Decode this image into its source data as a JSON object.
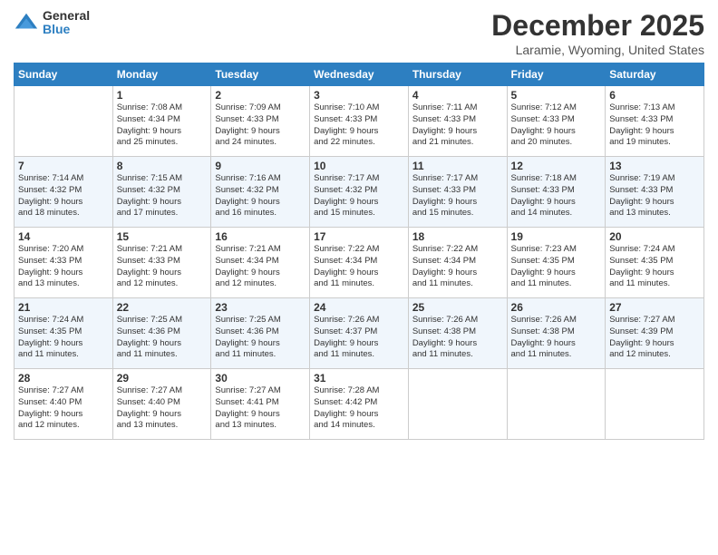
{
  "logo": {
    "general": "General",
    "blue": "Blue"
  },
  "title": "December 2025",
  "subtitle": "Laramie, Wyoming, United States",
  "days_of_week": [
    "Sunday",
    "Monday",
    "Tuesday",
    "Wednesday",
    "Thursday",
    "Friday",
    "Saturday"
  ],
  "weeks": [
    [
      {
        "num": "",
        "info": ""
      },
      {
        "num": "1",
        "info": "Sunrise: 7:08 AM\nSunset: 4:34 PM\nDaylight: 9 hours\nand 25 minutes."
      },
      {
        "num": "2",
        "info": "Sunrise: 7:09 AM\nSunset: 4:33 PM\nDaylight: 9 hours\nand 24 minutes."
      },
      {
        "num": "3",
        "info": "Sunrise: 7:10 AM\nSunset: 4:33 PM\nDaylight: 9 hours\nand 22 minutes."
      },
      {
        "num": "4",
        "info": "Sunrise: 7:11 AM\nSunset: 4:33 PM\nDaylight: 9 hours\nand 21 minutes."
      },
      {
        "num": "5",
        "info": "Sunrise: 7:12 AM\nSunset: 4:33 PM\nDaylight: 9 hours\nand 20 minutes."
      },
      {
        "num": "6",
        "info": "Sunrise: 7:13 AM\nSunset: 4:33 PM\nDaylight: 9 hours\nand 19 minutes."
      }
    ],
    [
      {
        "num": "7",
        "info": "Sunrise: 7:14 AM\nSunset: 4:32 PM\nDaylight: 9 hours\nand 18 minutes."
      },
      {
        "num": "8",
        "info": "Sunrise: 7:15 AM\nSunset: 4:32 PM\nDaylight: 9 hours\nand 17 minutes."
      },
      {
        "num": "9",
        "info": "Sunrise: 7:16 AM\nSunset: 4:32 PM\nDaylight: 9 hours\nand 16 minutes."
      },
      {
        "num": "10",
        "info": "Sunrise: 7:17 AM\nSunset: 4:32 PM\nDaylight: 9 hours\nand 15 minutes."
      },
      {
        "num": "11",
        "info": "Sunrise: 7:17 AM\nSunset: 4:33 PM\nDaylight: 9 hours\nand 15 minutes."
      },
      {
        "num": "12",
        "info": "Sunrise: 7:18 AM\nSunset: 4:33 PM\nDaylight: 9 hours\nand 14 minutes."
      },
      {
        "num": "13",
        "info": "Sunrise: 7:19 AM\nSunset: 4:33 PM\nDaylight: 9 hours\nand 13 minutes."
      }
    ],
    [
      {
        "num": "14",
        "info": "Sunrise: 7:20 AM\nSunset: 4:33 PM\nDaylight: 9 hours\nand 13 minutes."
      },
      {
        "num": "15",
        "info": "Sunrise: 7:21 AM\nSunset: 4:33 PM\nDaylight: 9 hours\nand 12 minutes."
      },
      {
        "num": "16",
        "info": "Sunrise: 7:21 AM\nSunset: 4:34 PM\nDaylight: 9 hours\nand 12 minutes."
      },
      {
        "num": "17",
        "info": "Sunrise: 7:22 AM\nSunset: 4:34 PM\nDaylight: 9 hours\nand 11 minutes."
      },
      {
        "num": "18",
        "info": "Sunrise: 7:22 AM\nSunset: 4:34 PM\nDaylight: 9 hours\nand 11 minutes."
      },
      {
        "num": "19",
        "info": "Sunrise: 7:23 AM\nSunset: 4:35 PM\nDaylight: 9 hours\nand 11 minutes."
      },
      {
        "num": "20",
        "info": "Sunrise: 7:24 AM\nSunset: 4:35 PM\nDaylight: 9 hours\nand 11 minutes."
      }
    ],
    [
      {
        "num": "21",
        "info": "Sunrise: 7:24 AM\nSunset: 4:35 PM\nDaylight: 9 hours\nand 11 minutes."
      },
      {
        "num": "22",
        "info": "Sunrise: 7:25 AM\nSunset: 4:36 PM\nDaylight: 9 hours\nand 11 minutes."
      },
      {
        "num": "23",
        "info": "Sunrise: 7:25 AM\nSunset: 4:36 PM\nDaylight: 9 hours\nand 11 minutes."
      },
      {
        "num": "24",
        "info": "Sunrise: 7:26 AM\nSunset: 4:37 PM\nDaylight: 9 hours\nand 11 minutes."
      },
      {
        "num": "25",
        "info": "Sunrise: 7:26 AM\nSunset: 4:38 PM\nDaylight: 9 hours\nand 11 minutes."
      },
      {
        "num": "26",
        "info": "Sunrise: 7:26 AM\nSunset: 4:38 PM\nDaylight: 9 hours\nand 11 minutes."
      },
      {
        "num": "27",
        "info": "Sunrise: 7:27 AM\nSunset: 4:39 PM\nDaylight: 9 hours\nand 12 minutes."
      }
    ],
    [
      {
        "num": "28",
        "info": "Sunrise: 7:27 AM\nSunset: 4:40 PM\nDaylight: 9 hours\nand 12 minutes."
      },
      {
        "num": "29",
        "info": "Sunrise: 7:27 AM\nSunset: 4:40 PM\nDaylight: 9 hours\nand 13 minutes."
      },
      {
        "num": "30",
        "info": "Sunrise: 7:27 AM\nSunset: 4:41 PM\nDaylight: 9 hours\nand 13 minutes."
      },
      {
        "num": "31",
        "info": "Sunrise: 7:28 AM\nSunset: 4:42 PM\nDaylight: 9 hours\nand 14 minutes."
      },
      {
        "num": "",
        "info": ""
      },
      {
        "num": "",
        "info": ""
      },
      {
        "num": "",
        "info": ""
      }
    ]
  ]
}
